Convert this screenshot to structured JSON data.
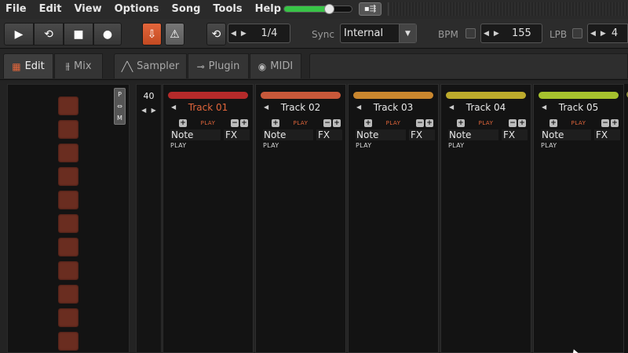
{
  "menu": [
    "File",
    "Edit",
    "View",
    "Options",
    "Song",
    "Tools",
    "Help"
  ],
  "master_volume": 0.68,
  "transport": {
    "play_icon": "play-icon",
    "loop_icon": "loop-icon",
    "stop_icon": "stop-icon",
    "record_icon": "record-icon"
  },
  "toolbar": {
    "step": "1/4",
    "sync_label": "Sync",
    "sync_value": "Internal",
    "bpm_label": "BPM",
    "bpm_value": "155",
    "lpb_label": "LPB",
    "lpb_value": "4"
  },
  "tabs": [
    {
      "label": "Edit",
      "icon": "grid-icon",
      "active": true
    },
    {
      "label": "Mix",
      "icon": "mixer-icon",
      "active": false
    },
    {
      "label": "Sampler",
      "icon": "waveform-icon",
      "active": false
    },
    {
      "label": "Plugin",
      "icon": "plug-icon",
      "active": false
    },
    {
      "label": "MIDI",
      "icon": "midi-icon",
      "active": false
    }
  ],
  "pattern": {
    "row_count": "40"
  },
  "tracks": [
    {
      "name": "Track 01",
      "color": "#b52a2a",
      "selected": true,
      "play_label": "PLAY",
      "note_label": "Note",
      "fx_label": "FX",
      "row_play": "PLAY"
    },
    {
      "name": "Track 02",
      "color": "#c8583a",
      "selected": false,
      "play_label": "PLAY",
      "note_label": "Note",
      "fx_label": "FX",
      "row_play": "PLAY"
    },
    {
      "name": "Track 03",
      "color": "#c9862e",
      "selected": false,
      "play_label": "PLAY",
      "note_label": "Note",
      "fx_label": "FX",
      "row_play": "PLAY"
    },
    {
      "name": "Track 04",
      "color": "#bcaa2c",
      "selected": false,
      "play_label": "PLAY",
      "note_label": "Note",
      "fx_label": "FX",
      "row_play": "PLAY"
    },
    {
      "name": "Track 05",
      "color": "#a6c12e",
      "selected": false,
      "play_label": "PLAY",
      "note_label": "Note",
      "fx_label": "FX",
      "row_play": "PLAY"
    }
  ],
  "accent_color": "#e3663b"
}
